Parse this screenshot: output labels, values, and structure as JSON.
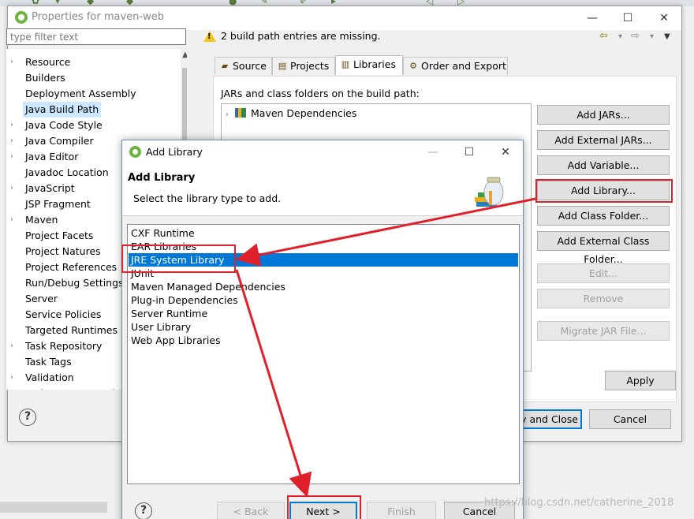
{
  "properties_window": {
    "title": "Properties for maven-web",
    "filter_placeholder": "type filter text",
    "tree_items": [
      {
        "label": "Resource",
        "expandable": true
      },
      {
        "label": "Builders",
        "expandable": false
      },
      {
        "label": "Deployment Assembly",
        "expandable": false
      },
      {
        "label": "Java Build Path",
        "expandable": false,
        "selected": true
      },
      {
        "label": "Java Code Style",
        "expandable": true
      },
      {
        "label": "Java Compiler",
        "expandable": true
      },
      {
        "label": "Java Editor",
        "expandable": true
      },
      {
        "label": "Javadoc Location",
        "expandable": false
      },
      {
        "label": "JavaScript",
        "expandable": true
      },
      {
        "label": "JSP Fragment",
        "expandable": false
      },
      {
        "label": "Maven",
        "expandable": true
      },
      {
        "label": "Project Facets",
        "expandable": false
      },
      {
        "label": "Project Natures",
        "expandable": false
      },
      {
        "label": "Project References",
        "expandable": false
      },
      {
        "label": "Run/Debug Settings",
        "expandable": false
      },
      {
        "label": "Server",
        "expandable": false
      },
      {
        "label": "Service Policies",
        "expandable": false
      },
      {
        "label": "Targeted Runtimes",
        "expandable": false
      },
      {
        "label": "Task Repository",
        "expandable": true
      },
      {
        "label": "Task Tags",
        "expandable": false
      },
      {
        "label": "Validation",
        "expandable": true
      },
      {
        "label": "Web Content Settings",
        "expandable": false
      }
    ],
    "message": "2 build path entries are missing.",
    "tabs": [
      {
        "label": "Source",
        "active": false
      },
      {
        "label": "Projects",
        "active": false
      },
      {
        "label": "Libraries",
        "active": true
      },
      {
        "label": "Order and Export",
        "active": false
      }
    ],
    "panel_label": "JARs and class folders on the build path:",
    "libraries": [
      {
        "label": "Maven Dependencies"
      }
    ],
    "buttons": {
      "add_jars": "Add JARs...",
      "add_external_jars": "Add External JARs...",
      "add_variable": "Add Variable...",
      "add_library": "Add Library...",
      "add_class_folder": "Add Class Folder...",
      "add_external_class_folder": "Add External Class Folder...",
      "edit": "Edit...",
      "remove": "Remove",
      "migrate_jar": "Migrate JAR File...",
      "apply": "Apply",
      "apply_and_close": "y and Close",
      "cancel": "Cancel"
    }
  },
  "add_library_dialog": {
    "title": "Add Library",
    "header_title": "Add Library",
    "header_description": "Select the library type to add.",
    "library_types": [
      {
        "label": "CXF Runtime"
      },
      {
        "label": "EAR Libraries"
      },
      {
        "label": "JRE System Library",
        "selected": true
      },
      {
        "label": "JUnit"
      },
      {
        "label": "Maven Managed Dependencies"
      },
      {
        "label": "Plug-in Dependencies"
      },
      {
        "label": "Server Runtime"
      },
      {
        "label": "User Library"
      },
      {
        "label": "Web App Libraries"
      }
    ],
    "buttons": {
      "back": "< Back",
      "next": "Next >",
      "finish": "Finish",
      "cancel": "Cancel"
    }
  },
  "watermark": "https://blog.csdn.net/catherine_2018",
  "colors": {
    "selection_blue": "#0078d7",
    "tree_selection": "#cce8ff",
    "annotation_red": "#e0202a",
    "spring_green": "#6db33f"
  }
}
